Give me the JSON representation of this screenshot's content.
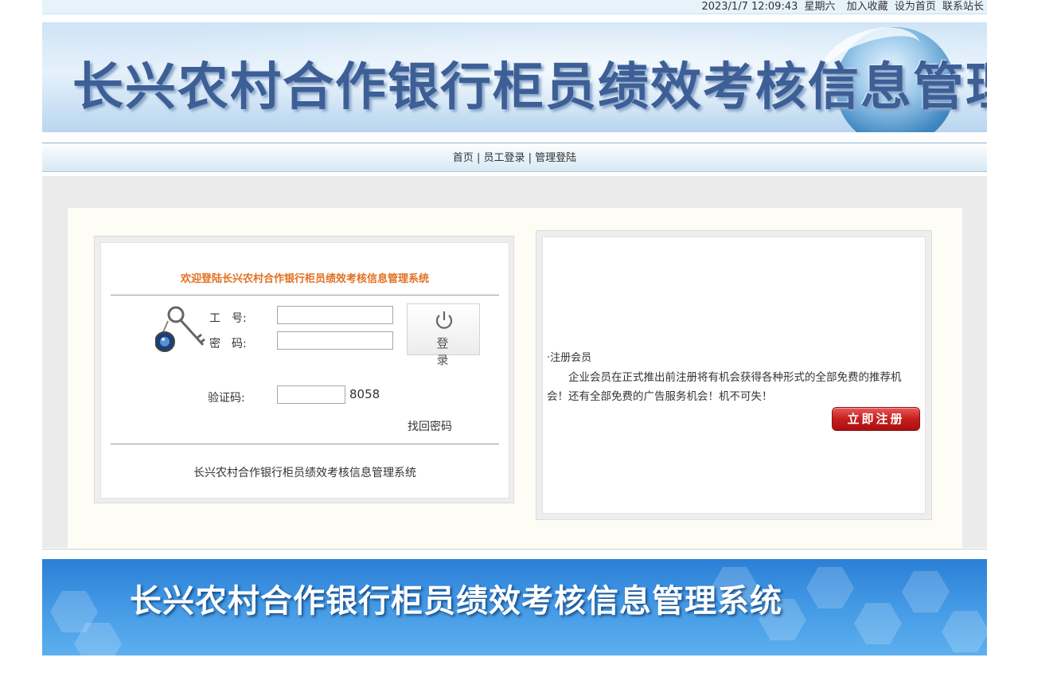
{
  "topbar": {
    "datetime": "2023/1/7 12:09:43",
    "weekday": "星期六",
    "bookmark": "加入收藏",
    "homepage": "设为首页",
    "contact": "联系站长"
  },
  "banner": {
    "title": "长兴农村合作银行柜员绩效考核信息管理系统"
  },
  "nav": {
    "home": "首页",
    "staff_login": "员工登录",
    "admin_login": "管理登陆",
    "separator": "|"
  },
  "login": {
    "welcome": "欢迎登陆长兴农村合作银行柜员绩效考核信息管理系统",
    "id_label": "工　号:",
    "password_label": "密　码:",
    "captcha_label": "验证码:",
    "captcha_code": "8058",
    "login_button": "登录",
    "forgot_password": "找回密码",
    "footer": "长兴农村合作银行柜员绩效考核信息管理系统",
    "id_value": "",
    "password_value": "",
    "captcha_value": ""
  },
  "register": {
    "title": "·注册会员",
    "description": "企业会员在正式推出前注册将有机会获得各种形式的全部免费的推荐机会！还有全部免费的广告服务机会！机不可失！",
    "button": "立即注册"
  },
  "footer_banner": {
    "title": "长兴农村合作银行柜员绩效考核信息管理系统"
  },
  "colors": {
    "accent_orange": "#e37020",
    "register_red": "#c81e1e",
    "banner_blue": "#3d5f96"
  }
}
